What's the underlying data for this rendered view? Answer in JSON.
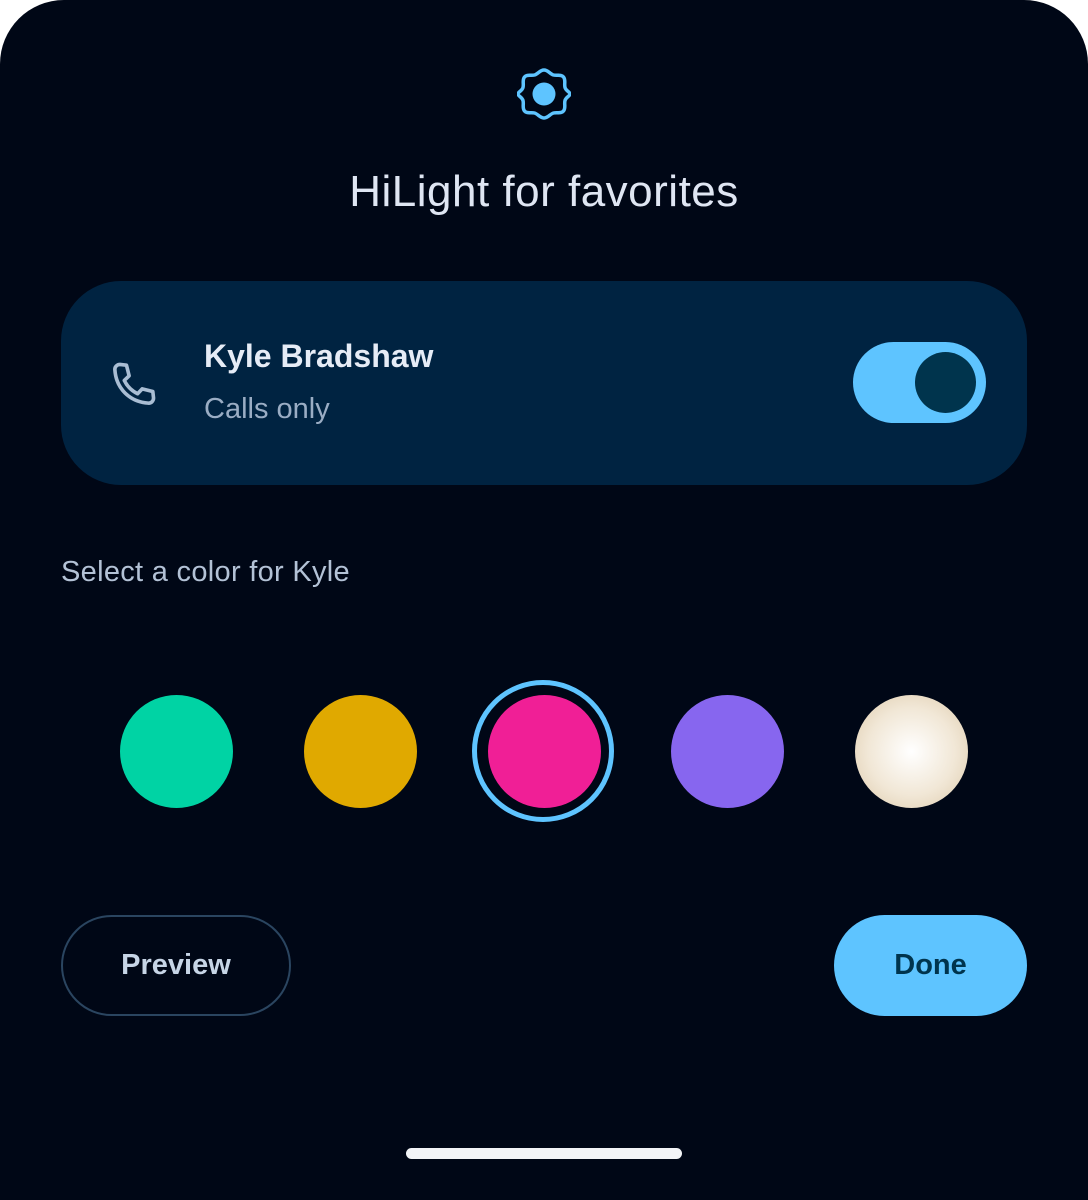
{
  "dialog": {
    "title": "HiLight for favorites",
    "header_icon": "scalloped-badge-icon"
  },
  "contact_card": {
    "icon": "phone-icon",
    "name": "Kyle Bradshaw",
    "subtitle": "Calls only",
    "toggle_on": true
  },
  "color_picker": {
    "label": "Select a color for Kyle",
    "selected_index": 2,
    "colors": [
      "#00d3a4",
      "#e0a900",
      "#f01f96",
      "#8766ef",
      "#f1e7d6"
    ]
  },
  "actions": {
    "preview_label": "Preview",
    "done_label": "Done"
  },
  "theme": {
    "background": "#000716",
    "card": "#002341",
    "accent": "#5ec4ff"
  }
}
